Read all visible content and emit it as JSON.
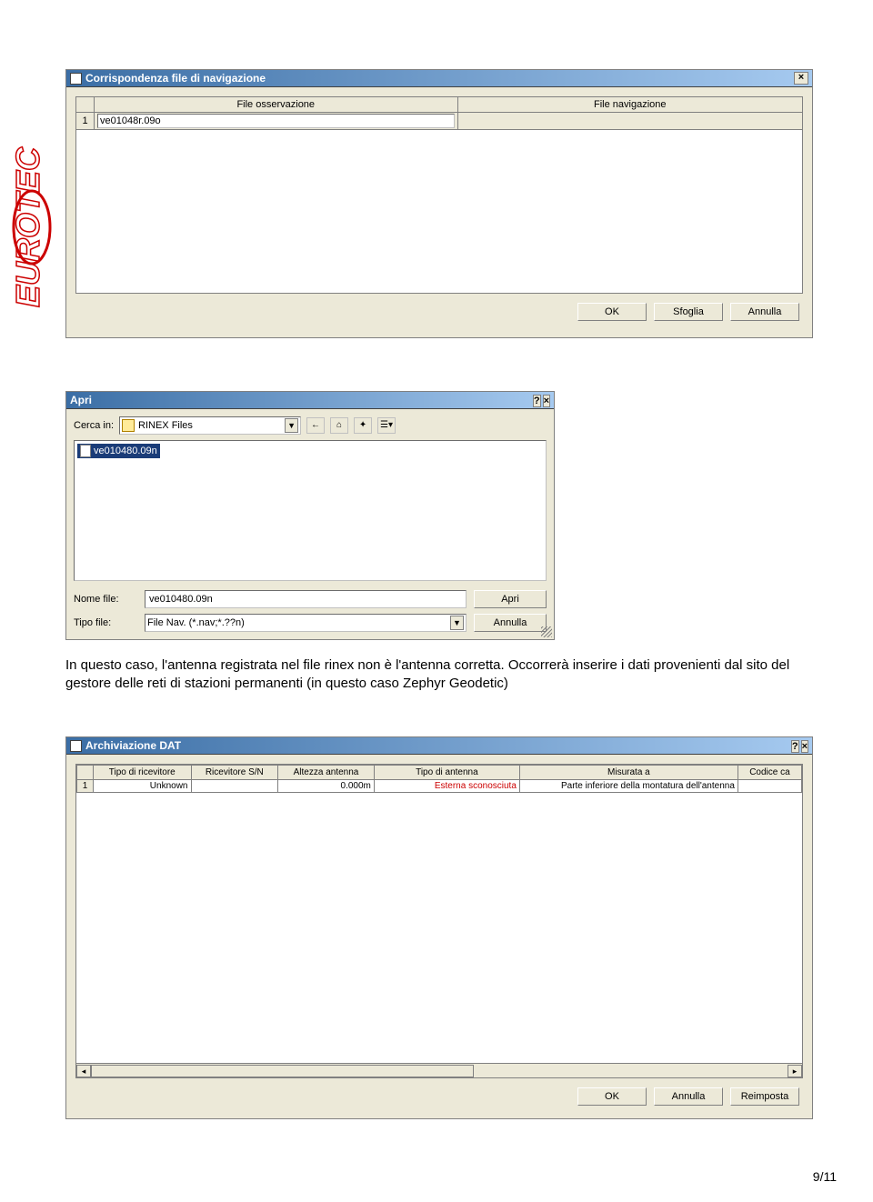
{
  "logo": {
    "text": "EUROTEC"
  },
  "dialog1": {
    "title": "Corrispondenza file di navigazione",
    "columns": {
      "oss": "File osservazione",
      "nav": "File navigazione"
    },
    "row": {
      "num": "1",
      "oss_value": "ve01048r.09o",
      "nav_value": ""
    },
    "buttons": {
      "ok": "OK",
      "sfoglia": "Sfoglia",
      "annulla": "Annulla"
    }
  },
  "dialog2": {
    "title": "Apri",
    "cerca_label": "Cerca in:",
    "cerca_value": "RINEX Files",
    "file_item": "ve010480.09n",
    "nome_label": "Nome file:",
    "nome_value": "ve010480.09n",
    "tipo_label": "Tipo file:",
    "tipo_value": "File Nav. (*.nav;*.??n)",
    "buttons": {
      "apri": "Apri",
      "annulla": "Annulla"
    }
  },
  "body_text": "In questo caso, l'antenna registrata nel file rinex non è l'antenna corretta. Occorrerà inserire i dati provenienti dal sito del gestore delle reti di stazioni permanenti (in questo caso Zephyr Geodetic)",
  "dialog3": {
    "title": "Archiviazione DAT",
    "columns": {
      "tipo_ric": "Tipo di ricevitore",
      "ric_sn": "Ricevitore S/N",
      "alt_ant": "Altezza antenna",
      "tipo_ant": "Tipo di antenna",
      "misurata": "Misurata a",
      "codice": "Codice ca"
    },
    "row": {
      "num": "1",
      "tipo_ric": "Unknown",
      "ric_sn": "",
      "alt_ant": "0.000m",
      "tipo_ant": "Esterna sconosciuta",
      "misurata": "Parte inferiore della montatura dell'antenna",
      "codice": ""
    },
    "buttons": {
      "ok": "OK",
      "annulla": "Annulla",
      "reimposta": "Reimposta"
    }
  },
  "page_number": "9/11"
}
